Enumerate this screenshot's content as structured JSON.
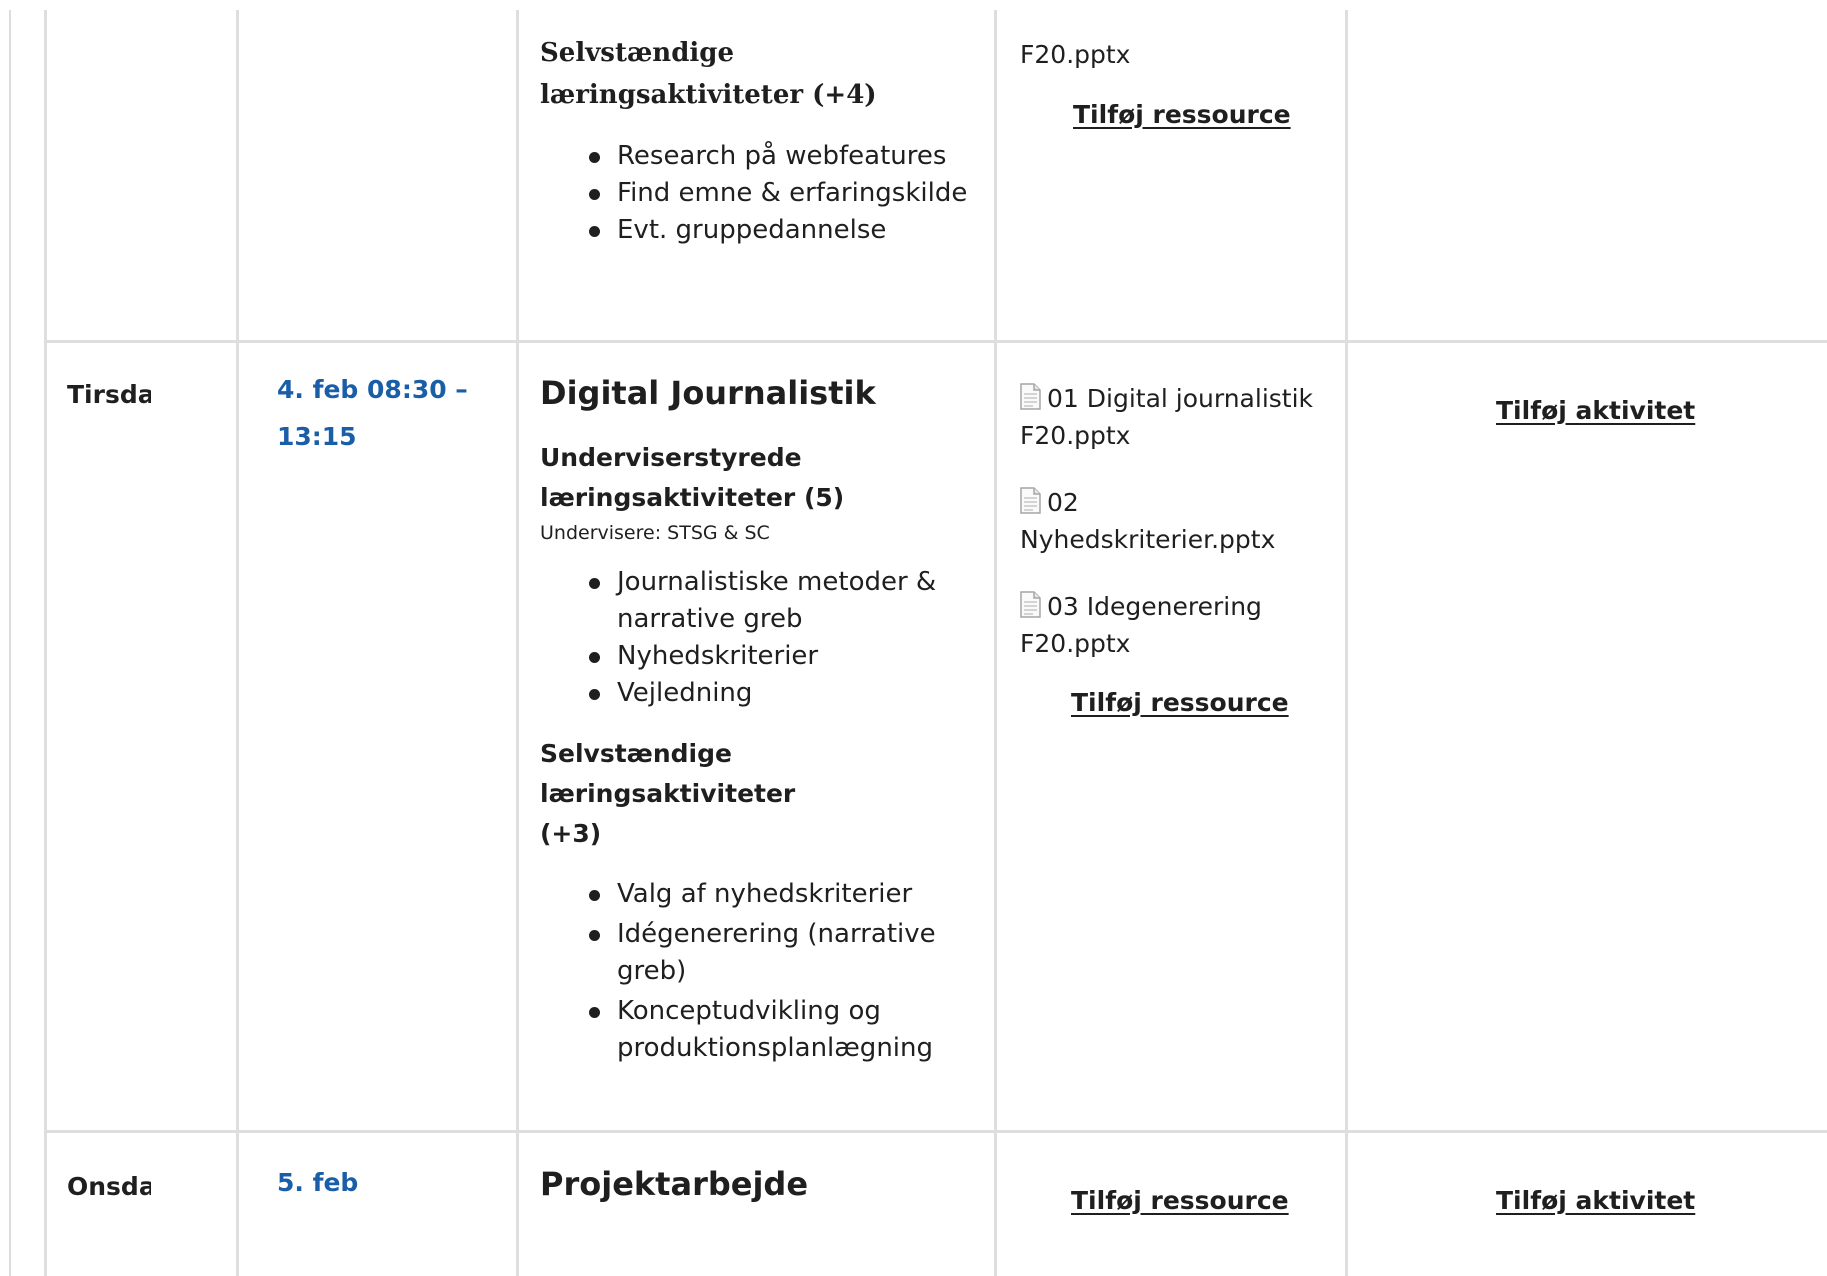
{
  "rows": [
    {
      "self_heading": "Selvstændige læringsaktiviteter (+4)",
      "self_items": [
        "Research på webfeatures",
        "Find emne & erfaringskilde",
        "Evt. gruppedannelse"
      ],
      "resource_tail": "F20.pptx",
      "add_resource": "Tilføj ressource"
    },
    {
      "day": "Tirsda",
      "date": "4. feb 08:30 – 13:15",
      "subject": "Digital Journalistik",
      "teacher_heading": "Underviserstyrede læringsaktiviteter (5)",
      "teachers": "Undervisere: STSG & SC",
      "teacher_items": [
        "Journalistiske metoder & narrative greb",
        "Nyhedskriterier",
        "Vejledning"
      ],
      "self_heading": "Selvstændige læringsaktiviteter (+3)",
      "self_items": [
        "Valg af nyhedskriterier",
        "Idégenerering (narrative greb)",
        "Konceptudvikling og produktionsplanlægning"
      ],
      "resources": [
        "01 Digital journalistik F20.pptx",
        "02 Nyhedskriterier.pptx",
        "03 Idegenerering F20.pptx"
      ],
      "add_resource": "Tilføj ressource",
      "add_activity": "Tilføj aktivitet"
    },
    {
      "day": "Onsda",
      "date": "5. feb",
      "subject": "Projektarbejde",
      "add_resource": "Tilføj ressource",
      "add_activity": "Tilføj aktivitet"
    }
  ],
  "icons": {
    "resource_file": "document-icon"
  }
}
